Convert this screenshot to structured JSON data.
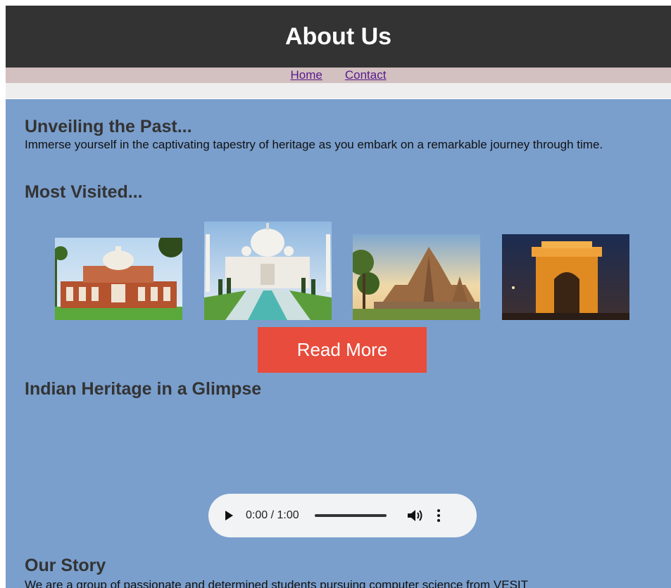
{
  "header": {
    "title": "About Us"
  },
  "nav": {
    "items": [
      {
        "label": "Home"
      },
      {
        "label": "Contact"
      }
    ]
  },
  "sections": {
    "unveiling": {
      "heading": "Unveiling the Past...",
      "text": "Immerse yourself in the captivating tapestry of heritage as you embark on a remarkable journey through time."
    },
    "most_visited": {
      "heading": "Most Visited..."
    },
    "glimpse": {
      "heading": "Indian Heritage in a Glimpse"
    },
    "story": {
      "heading": "Our Story",
      "text": "We are a group of passionate and determined students pursuing computer science from VESIT"
    }
  },
  "gallery": {
    "images": [
      {
        "name": "humayun-tomb-image"
      },
      {
        "name": "taj-mahal-image"
      },
      {
        "name": "khajuraho-temple-image"
      },
      {
        "name": "india-gate-image"
      }
    ]
  },
  "read_more": {
    "label": "Read More"
  },
  "audio": {
    "time": "0:00 / 1:00"
  }
}
